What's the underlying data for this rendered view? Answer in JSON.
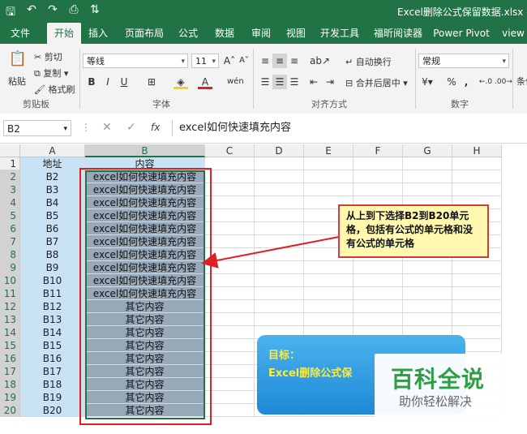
{
  "window": {
    "title": "Excel删除公式保留数据.xlsx  -  Ex"
  },
  "tabs": [
    "文件",
    "开始",
    "插入",
    "页面布局",
    "公式",
    "数据",
    "审阅",
    "视图",
    "开发工具",
    "福昕阅读器",
    "Power Pivot",
    "view"
  ],
  "active_tab": "开始",
  "ribbon": {
    "clipboard": {
      "paste": "粘贴",
      "cut": "剪切",
      "copy": "复制",
      "format_painter": "格式刷",
      "label": "剪贴板"
    },
    "font": {
      "name": "等线",
      "size": "11",
      "bold": "B",
      "italic": "I",
      "underline": "U",
      "label": "字体"
    },
    "alignment": {
      "wrap": "自动换行",
      "merge": "合并后居中",
      "label": "对齐方式"
    },
    "number": {
      "format": "常规",
      "percent": "%",
      "comma": ",",
      "label": "数字"
    },
    "styles": {
      "conditional": "条件"
    }
  },
  "formula_bar": {
    "name_box": "B2",
    "fx": "fx",
    "content": "excel如何快速填充内容"
  },
  "columns": [
    "A",
    "B",
    "C",
    "D",
    "E",
    "F",
    "G",
    "H"
  ],
  "header_row": {
    "a": "地址",
    "b": "内容"
  },
  "rows": [
    {
      "a": "B2",
      "b": "excel如何快速填充内容"
    },
    {
      "a": "B3",
      "b": "excel如何快速填充内容"
    },
    {
      "a": "B4",
      "b": "excel如何快速填充内容"
    },
    {
      "a": "B5",
      "b": "excel如何快速填充内容"
    },
    {
      "a": "B6",
      "b": "excel如何快速填充内容"
    },
    {
      "a": "B7",
      "b": "excel如何快速填充内容"
    },
    {
      "a": "B8",
      "b": "excel如何快速填充内容"
    },
    {
      "a": "B9",
      "b": "excel如何快速填充内容"
    },
    {
      "a": "B10",
      "b": "excel如何快速填充内容"
    },
    {
      "a": "B11",
      "b": "excel如何快速填充内容"
    },
    {
      "a": "B12",
      "b": "其它内容"
    },
    {
      "a": "B13",
      "b": "其它内容"
    },
    {
      "a": "B14",
      "b": "其它内容"
    },
    {
      "a": "B15",
      "b": "其它内容"
    },
    {
      "a": "B16",
      "b": "其它内容"
    },
    {
      "a": "B17",
      "b": "其它内容"
    },
    {
      "a": "B18",
      "b": "其它内容"
    },
    {
      "a": "B19",
      "b": "其它内容"
    },
    {
      "a": "B20",
      "b": "其它内容"
    }
  ],
  "callout": {
    "text": "从上到下选择B2到B20单元格，包括有公式的单元格和没有公式的单元格"
  },
  "goal": {
    "label": "目标：",
    "text": "Excel删除公式保"
  },
  "watermark": {
    "title": "百科全说",
    "subtitle": "助你轻松解决"
  }
}
